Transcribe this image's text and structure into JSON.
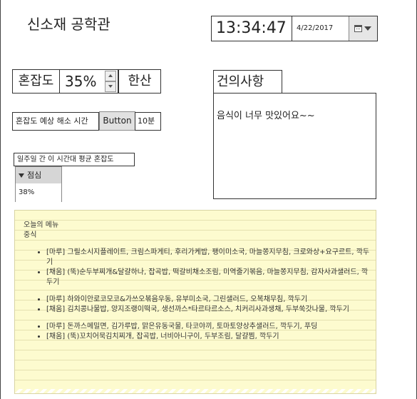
{
  "app": {
    "title": "신소재 공학관"
  },
  "clock": {
    "time": "13:34:47",
    "date": "4/22/2017"
  },
  "congestion": {
    "label": "혼잡도",
    "value": "35%",
    "level": "한산"
  },
  "suggestion": {
    "title": "건의사항",
    "text": "음식이 너무 맛있어요~~"
  },
  "clear_time": {
    "label": "혼잡도 예상 해소 시간",
    "button": "Button",
    "value": "10분"
  },
  "weekly_avg": {
    "label": "일주일 간 이 시간대 평균 혼잡도",
    "column": "점심",
    "value": "38%"
  },
  "menu": {
    "title": "오늘의 메뉴",
    "subtitle": "중식",
    "groups": [
      [
        "[마루] 그릴소시지플레이트, 크림스파게티, 후리가케밥, 팽이미소국, 마늘쫑지무침, 크로와상+요구르트, 깍두기",
        "[채움] (뚝)순두부찌개&달걀하나, 잡곡밥, 떡갈비채소조림, 미역줄기볶음, 마늘쫑지무침, 감자사과샐러드, 깍두기"
      ],
      [
        "[마루] 하와이안로코모코&가쓰오볶음우동, 유부미소국, 그린샐러드, 오복채무침, 깍두기",
        "[채움] 김치콩나물밥, 양지조랭이떡국, 생선까스*타르타르소스, 치커리사과생채, 두부쑥갓나물, 깍두기"
      ],
      [
        "[마루] 돈까스메밀면, 김가루밥, 맑은유동국물, 타코야끼, 토마토양상추샐러드, 깍두기, 푸딩",
        "[채움] (뚝)꼬치어묵김치찌개, 잡곡밥, 너비아니구이, 두부조림, 달걀찜, 깍두기"
      ]
    ]
  }
}
